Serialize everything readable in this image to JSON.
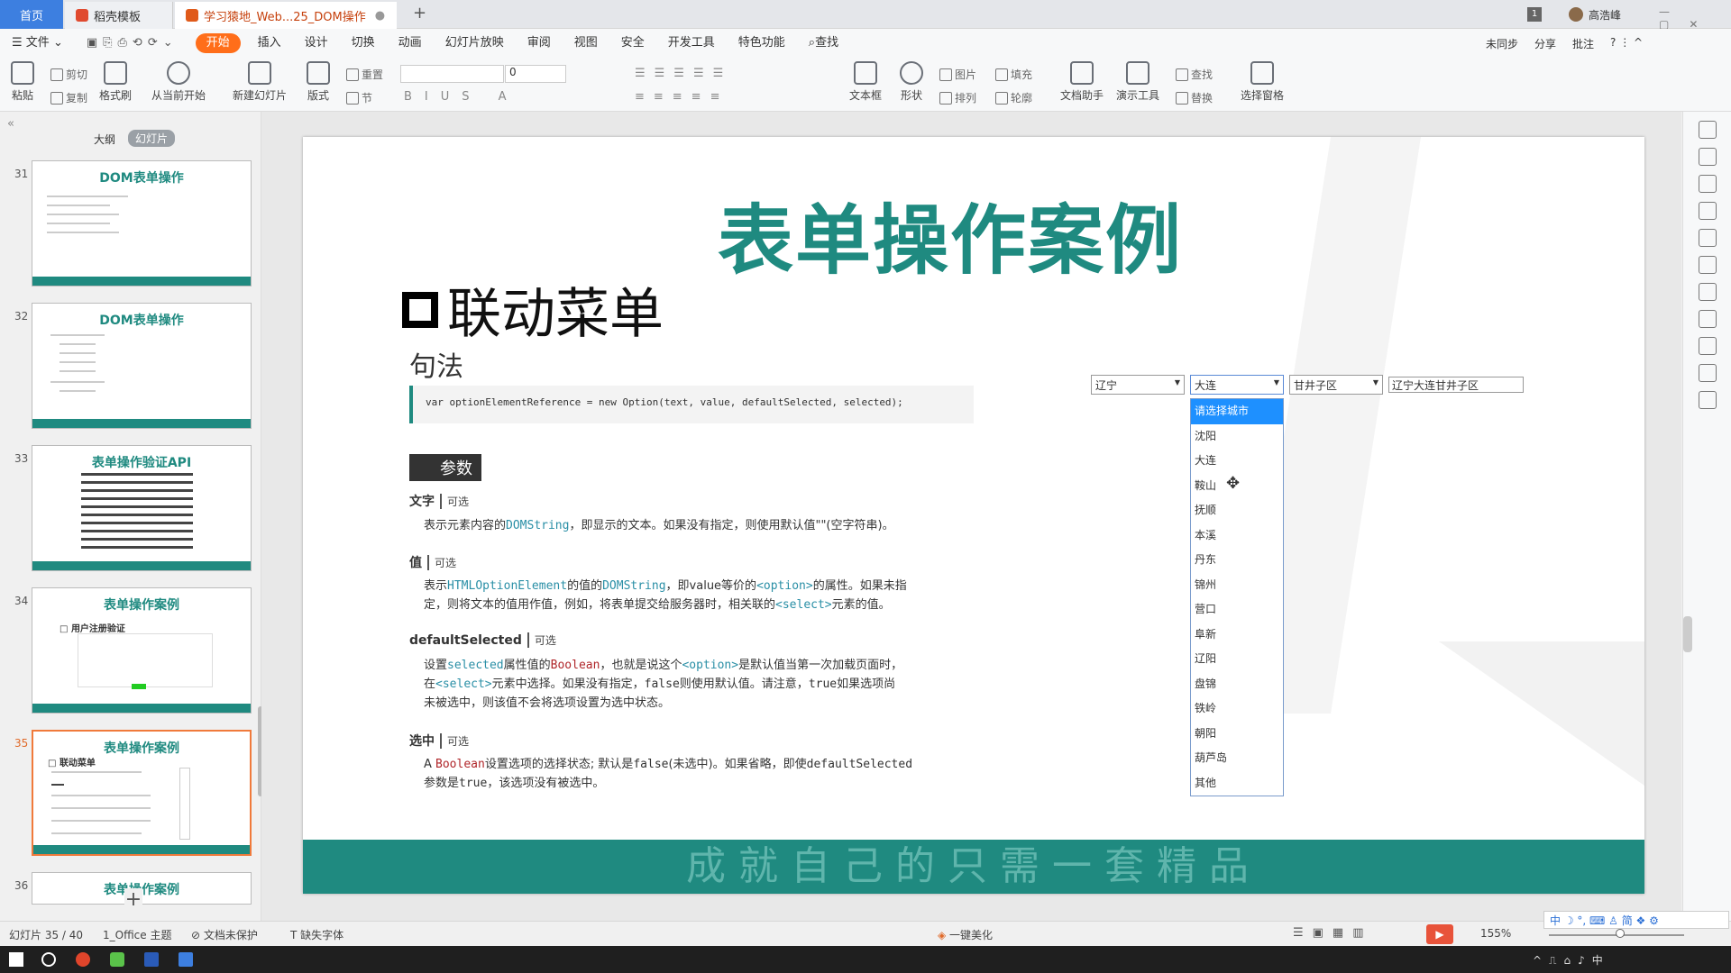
{
  "tabs": {
    "home": "首页",
    "t2": "稻壳模板",
    "t3": "学习猿地_Web...25_DOM操作"
  },
  "titlebar": {
    "badge": "1",
    "user": "高浩峰"
  },
  "menu": [
    "文件",
    "开始",
    "插入",
    "设计",
    "切换",
    "动画",
    "幻灯片放映",
    "审阅",
    "视图",
    "安全",
    "开发工具",
    "特色功能",
    "查找"
  ],
  "menu_right": [
    "未同步",
    "分享",
    "批注"
  ],
  "ribbon": {
    "paste": "粘贴",
    "cut": "剪切",
    "copy": "复制",
    "format": "格式刷",
    "from_start": "从当前开始",
    "new_slide": "新建幻灯片",
    "layout": "版式",
    "reset": "重置",
    "section": "节",
    "font_size": "0",
    "textbox": "文本框",
    "shape": "形状",
    "picture": "图片",
    "fill": "填充",
    "arrange": "排列",
    "outline": "轮廓",
    "doc_helper": "文档助手",
    "present_tool": "演示工具",
    "find": "查找",
    "replace": "替换",
    "select_pane": "选择窗格"
  },
  "panel": {
    "outline": "大纲",
    "slides": "幻灯片"
  },
  "thumbs": [
    {
      "num": "31",
      "title": "DOM表单操作"
    },
    {
      "num": "32",
      "title": "DOM表单操作"
    },
    {
      "num": "33",
      "title": "表单操作验证API"
    },
    {
      "num": "34",
      "title": "表单操作案例",
      "sub": "用户注册验证"
    },
    {
      "num": "35",
      "title": "表单操作案例",
      "sub": "联动菜单"
    },
    {
      "num": "36",
      "title": "表单操作案例"
    }
  ],
  "slide": {
    "title": "表单操作案例",
    "subtitle": "联动菜单",
    "syntax_label": "句法",
    "code": "var optionElementReference = new Option(text, value, defaultSelected, selected);",
    "params_label": "参数",
    "p1_name": "文字",
    "p1_tag": "可选",
    "p1_a": "表示元素内容的",
    "p1_b": "DOMString",
    "p1_c": "，即显示的文本。如果没有指定，则使用默认值\"\"(空字符串)。",
    "p2_name": "值",
    "p2_tag": "可选",
    "p2_l1a": "表示",
    "p2_l1b": "HTMLOptionElement",
    "p2_l1c": "的值的",
    "p2_l1d": "DOMString",
    "p2_l1e": "，即value等价的",
    "p2_l1f": "<option>",
    "p2_l1g": "的属性。如果未指",
    "p2_l2a": "定，则将文本的值用作值，例如，将表单提交给服务器时，相关联的",
    "p2_l2b": "<select>",
    "p2_l2c": "元素的值。",
    "p3_name": "defaultSelected",
    "p3_tag": "可选",
    "p3_l1a": "设置",
    "p3_l1b": "selected",
    "p3_l1c": "属性值的",
    "p3_l1d": "Boolean",
    "p3_l1e": "，也就是说这个",
    "p3_l1f": "<option>",
    "p3_l1g": "是默认值当第一次加载页面时，",
    "p3_l2a": "在",
    "p3_l2b": "<select>",
    "p3_l2c": "元素中选择。如果没有指定，",
    "p3_l2d": "false",
    "p3_l2e": "则使用默认值。请注意，",
    "p3_l2f": "true",
    "p3_l2g": "如果选项尚",
    "p3_l3": "未被选中，则该值不会将选项设置为选中状态。",
    "p4_name": "选中",
    "p4_tag": "可选",
    "p4_l1a": "A ",
    "p4_l1b": "Boolean",
    "p4_l1c": "设置选项的选择状态; 默认是",
    "p4_l1d": "false",
    "p4_l1e": "(未选中)。如果省略，即使",
    "p4_l1f": "defaultSelected",
    "p4_l2a": "参数是",
    "p4_l2b": "true",
    "p4_l2c": "，该选项没有被选中。",
    "province": "辽宁",
    "city": "大连",
    "district": "甘井子区",
    "result": "辽宁大连甘井子区",
    "options": [
      "请选择城市",
      "沈阳",
      "大连",
      "鞍山",
      "抚顺",
      "本溪",
      "丹东",
      "锦州",
      "营口",
      "阜新",
      "辽阳",
      "盘锦",
      "铁岭",
      "朝阳",
      "葫芦岛",
      "其他"
    ],
    "footer": "成就自己的只需一套精品"
  },
  "status": {
    "slide": "幻灯片 35 / 40",
    "theme": "1_Office 主题",
    "protect": "文档未保护",
    "font": "缺失字体",
    "beautify": "一键美化",
    "zoom": "155%"
  },
  "ime": "中"
}
